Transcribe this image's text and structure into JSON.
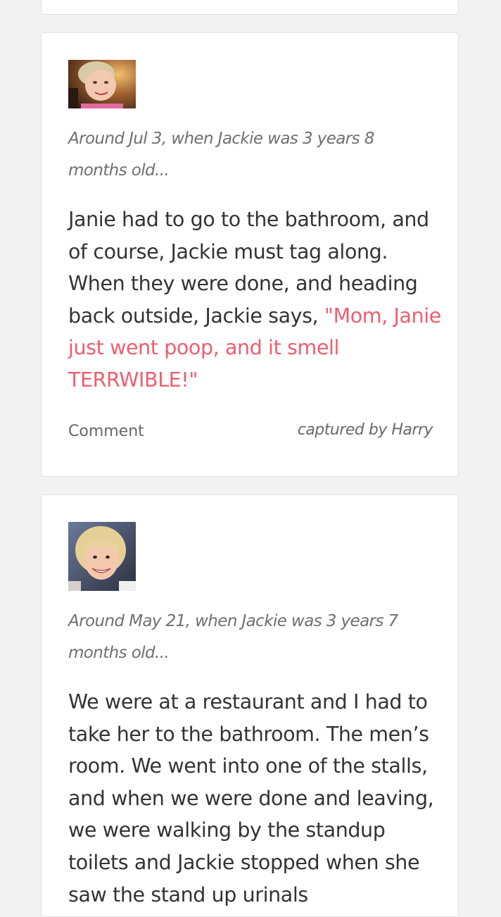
{
  "moments": [
    {
      "meta": "Around Jul 3, when Jackie was 3 years 8 months old...",
      "story_plain": "Janie had to go to the bathroom, and of course, Jackie must tag along. When they were done, and heading back outside, Jackie says, ",
      "story_quote": "\"Mom, Janie just went poop, and it smell TERRWIBLE!\"",
      "comment_label": "Comment",
      "captured_by": "captured by Harry"
    },
    {
      "meta": "Around May 21, when Jackie was 3 years 7 months old...",
      "story_plain": "We were at a restaurant and I had to take her to the bathroom. The men’s room. We went into one of the stalls, and when we were done and leaving, we were walking by the standup toilets and Jackie stopped when she saw the stand up urinals"
    }
  ],
  "colors": {
    "background": "#f2f2f2",
    "card": "#ffffff",
    "quote": "#ee5e6e",
    "meta": "#6f6f6f",
    "body_text": "#333333"
  }
}
